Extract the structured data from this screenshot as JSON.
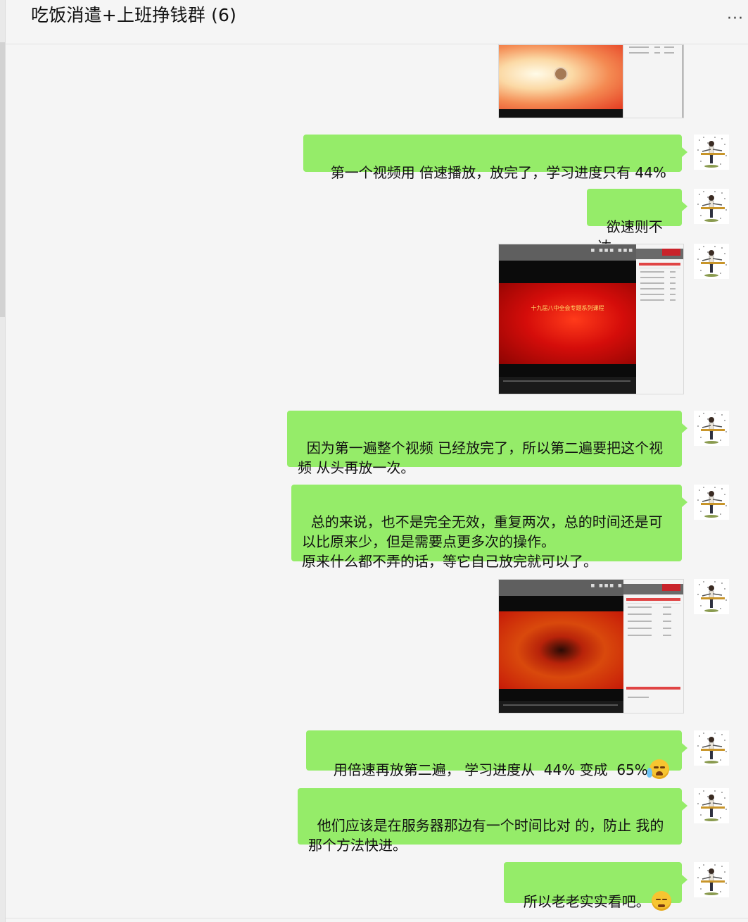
{
  "header": {
    "title": "吃饭消遣+上班挣钱群 (6)",
    "more": "···"
  },
  "messages": [
    {
      "type": "video",
      "id": "video-1"
    },
    {
      "type": "text",
      "text": "第一个视频用 倍速播放，放完了，学习进度只有 44%"
    },
    {
      "type": "text",
      "text": "欲速则不达"
    },
    {
      "type": "video",
      "id": "video-2",
      "screen_text": "十九届八中全会专题系列课程"
    },
    {
      "type": "text",
      "text": "因为第一遍整个视频 已经放完了，所以第二遍要把这个视\n频 从头再放一次。"
    },
    {
      "type": "text",
      "text": "总的来说，也不是完全无效，重复两次，总的时间还是可\n以比原来少，但是需要点更多次的操作。\n原来什么都不弄的话，等它自己放完就可以了。"
    },
    {
      "type": "video",
      "id": "video-3"
    },
    {
      "type": "text",
      "text": "用倍速再放第二遍， 学习进度从  44% 变成  65%",
      "emoji": "tears-of-joy-emoji"
    },
    {
      "type": "text",
      "text": "他们应该是在服务器那边有一个时间比对 的，防止 我的\n那个方法快进。"
    },
    {
      "type": "text",
      "text": "所以老老实实看吧。",
      "emoji": "sad-face-emoji"
    }
  ],
  "colors": {
    "bubble": "#95ec69",
    "background": "#f5f5f5"
  }
}
